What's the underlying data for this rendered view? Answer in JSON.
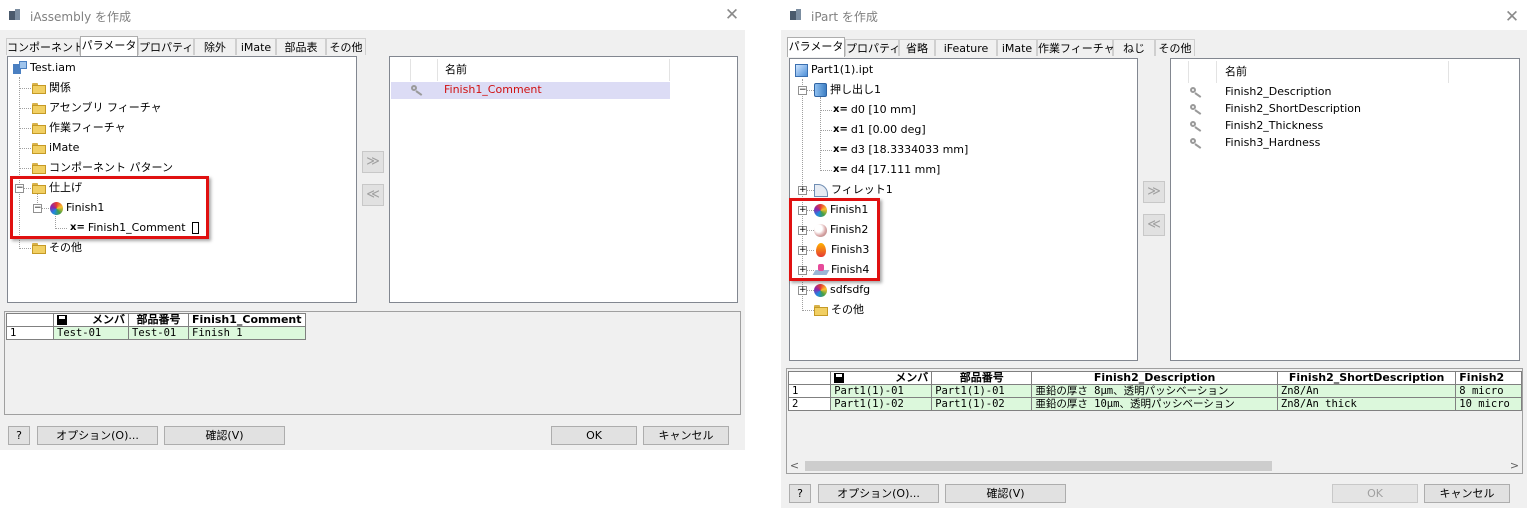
{
  "dialog_a": {
    "title": "iAssembly を作成",
    "close": "✕",
    "tabs": [
      "コンポーネント",
      "パラメータ",
      "プロパティ",
      "除外",
      "iMate",
      "部品表",
      "その他"
    ],
    "active_tab": "パラメータ",
    "tree": {
      "root": "Test.iam",
      "items": [
        "関係",
        "アセンブリ フィーチャ",
        "作業フィーチャ",
        "iMate",
        "コンポーネント パターン",
        "仕上げ"
      ],
      "finish_node": "Finish1",
      "param_prefix": "x=",
      "param_node": "Finish1_Comment",
      "last_folder": "その他"
    },
    "move_right": "≫",
    "move_left": "≪",
    "list_header": "名前",
    "list_items": [
      "Finish1_Comment"
    ],
    "table": {
      "headers": [
        "メンバ",
        "部品番号",
        "Finish1_Comment"
      ],
      "rows": [
        [
          "1",
          "Test-01",
          "Test-01",
          "Finish 1"
        ]
      ]
    },
    "buttons": {
      "help": "?",
      "options": "オプション(O)...",
      "verify": "確認(V)",
      "ok": "OK",
      "cancel": "キャンセル"
    },
    "highlight_color": "#e01010"
  },
  "dialog_b": {
    "title": "iPart を作成",
    "close": "✕",
    "tabs": [
      "パラメータ",
      "プロパティ",
      "省略",
      "iFeature",
      "iMate",
      "作業フィーチャ",
      "ねじ",
      "その他"
    ],
    "active_tab": "パラメータ",
    "tree": {
      "root": "Part1(1).ipt",
      "extrude": "押し出し1",
      "param_prefix": "x=",
      "params": [
        "d0 [10 mm]",
        "d1 [0.00 deg]",
        "d3 [18.3334033 mm]",
        "d4 [17.111 mm]"
      ],
      "fillet": "フィレット1",
      "finishes": [
        "Finish1",
        "Finish2",
        "Finish3",
        "Finish4"
      ],
      "sdf": "sdfsdfg",
      "last_folder": "その他"
    },
    "move_right": "≫",
    "move_left": "≪",
    "list_header": "名前",
    "list_items": [
      "Finish2_Description",
      "Finish2_ShortDescription",
      "Finish2_Thickness",
      "Finish3_Hardness"
    ],
    "table": {
      "headers": [
        "メンバ",
        "部品番号",
        "Finish2_Description",
        "Finish2_ShortDescription",
        "Finish2"
      ],
      "rows": [
        [
          "1",
          "Part1(1)-01",
          "Part1(1)-01",
          "亜鉛の厚さ 8μm、透明パッシベーション",
          "Zn8/An",
          "8 micro"
        ],
        [
          "2",
          "Part1(1)-02",
          "Part1(1)-02",
          "亜鉛の厚さ 10μm、透明パッシベーション",
          "Zn8/An thick",
          "10 micro"
        ]
      ]
    },
    "scroll_left": "<",
    "scroll_right": ">",
    "buttons": {
      "help": "?",
      "options": "オプション(O)...",
      "verify": "確認(V)",
      "ok": "OK",
      "cancel": "キャンセル"
    }
  }
}
